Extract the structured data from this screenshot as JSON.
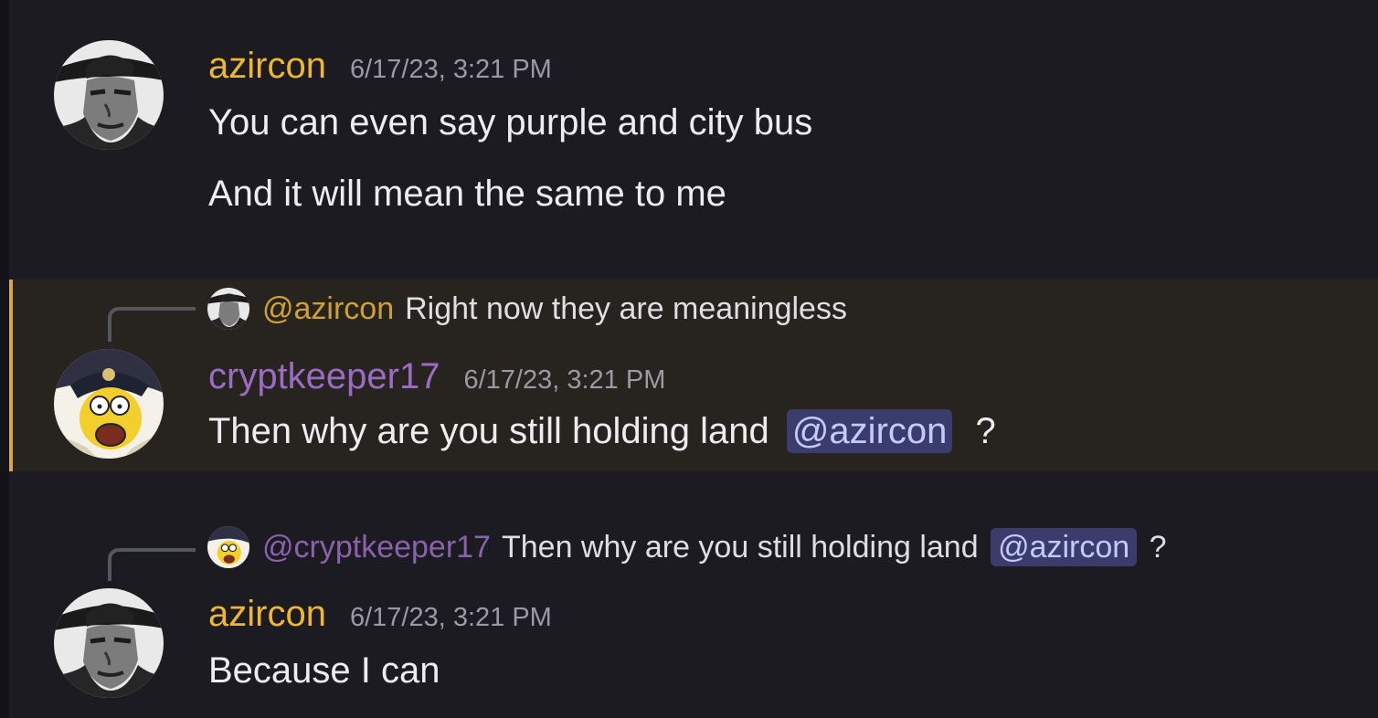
{
  "messages": [
    {
      "author": "azircon",
      "timestamp": "6/17/23, 3:21 PM",
      "lines": [
        "You can even say purple and city bus",
        "And it will mean the same to me"
      ]
    },
    {
      "author": "cryptkeeper17",
      "timestamp": "6/17/23, 3:21 PM",
      "highlighted": true,
      "reply": {
        "author": "@azircon",
        "text": "Right now they are meaningless"
      },
      "text_before": "Then why are you still holding land",
      "mention": "@azircon",
      "text_after": "?"
    },
    {
      "author": "azircon",
      "timestamp": "6/17/23, 3:21 PM",
      "reply": {
        "author": "@cryptkeeper17",
        "text_before": "Then why are you still holding land",
        "mention": "@azircon",
        "text_after": "?"
      },
      "text": "Because I can"
    }
  ],
  "colors": {
    "background": "#1c1b21",
    "highlight_background": "#27231f",
    "highlight_bar": "#d9a54a",
    "azircon_name": "#f0b72e",
    "cryptkeeper_name": "#9b6cc4",
    "mention_bg": "#3a3d6b",
    "mention_text": "#c4caff",
    "timestamp": "#9a9aa3"
  },
  "icons": {
    "azircon_avatar": "cowboy-portrait-avatar-icon",
    "cryptkeeper_avatar": "cartoon-pirate-avatar-icon"
  }
}
